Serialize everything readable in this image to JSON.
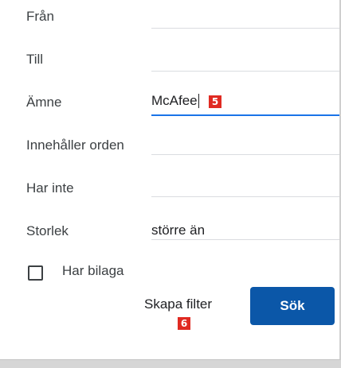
{
  "form": {
    "from_label": "Från",
    "to_label": "Till",
    "subject_label": "Ämne",
    "subject_value": "McAfee",
    "has_words_label": "Innehåller orden",
    "doesnt_have_label": "Har inte",
    "size_label": "Storlek",
    "size_value": "större än",
    "has_attachment_label": "Har bilaga",
    "has_attachment_checked": false
  },
  "buttons": {
    "create_filter_label": "Skapa filter",
    "search_label": "Sök"
  },
  "annotations": {
    "badge_subject": "5",
    "badge_create_filter": "6"
  },
  "colors": {
    "accent": "#1a73e8",
    "primary_button": "#0b57a8",
    "badge": "#e02a22"
  }
}
